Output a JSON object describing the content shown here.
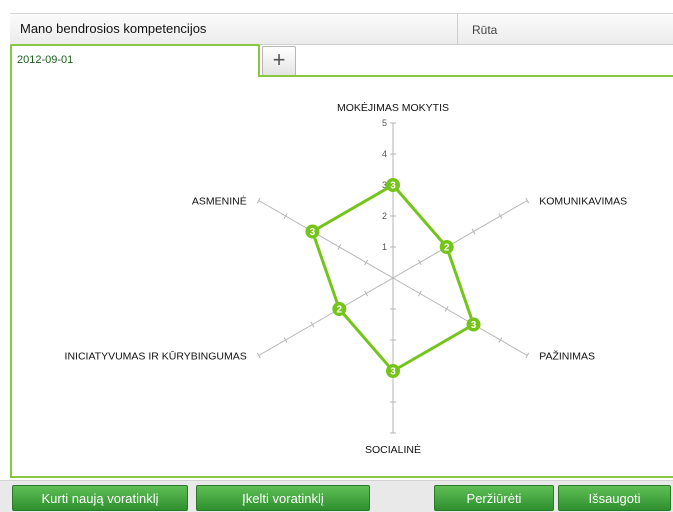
{
  "header": {
    "title": "Mano bendrosios kompetencijos",
    "user": "Rūta"
  },
  "tab": {
    "date": "2012-09-01",
    "add_label": "+"
  },
  "chart_data": {
    "type": "radar",
    "axes": [
      "MOKĖJIMAS MOKYTIS",
      "KOMUNIKAVIMAS",
      "PAŽINIMAS",
      "SOCIALINĖ",
      "INICIATYVUMAS IR KŪRYBINGUMAS",
      "ASMENINĖ"
    ],
    "values": [
      3,
      2,
      3,
      3,
      2,
      3
    ],
    "range": [
      0,
      5
    ],
    "ticks": [
      "1",
      "2",
      "3",
      "4",
      "5"
    ],
    "series_color": "#74c41a"
  },
  "buttons": {
    "create": "Kurti naują voratinklį",
    "upload": "Įkelti voratinklį",
    "view": "Peržiūrėti",
    "save": "Išsaugoti"
  }
}
